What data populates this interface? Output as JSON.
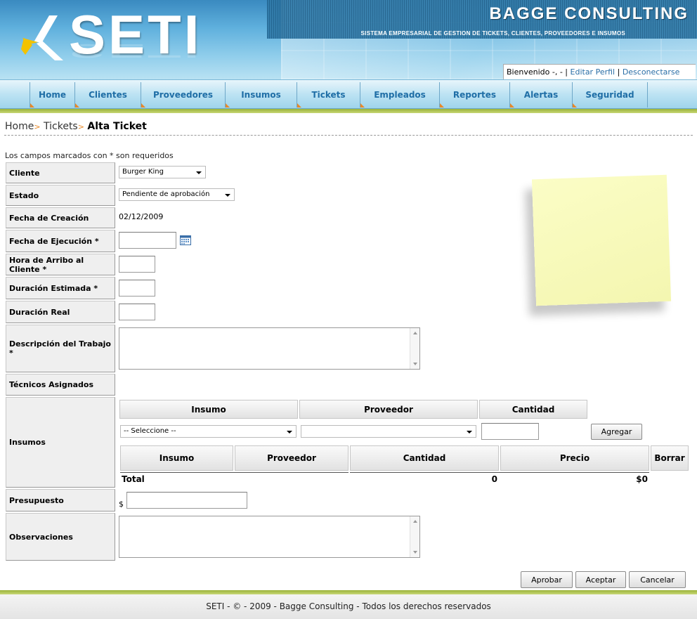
{
  "header": {
    "logo_text": "SETI",
    "company": "BAGGE CONSULTING",
    "tagline": "SISTEMA EMPRESARIAL DE GESTION DE TICKETS, CLIENTES, PROVEEDORES E INSUMOS",
    "welcome": "Bienvenido -, -",
    "separator": "|",
    "edit_profile": "Editar Perfil",
    "logout": "Desconectarse"
  },
  "nav": [
    "Home",
    "Clientes",
    "Proveedores",
    "Insumos",
    "Tickets",
    "Empleados",
    "Reportes",
    "Alertas",
    "Seguridad"
  ],
  "breadcrumb": {
    "home": "Home",
    "sep": ">",
    "tickets": "Tickets",
    "current": "Alta Ticket"
  },
  "required_note": "Los campos marcados con * son requeridos",
  "form": {
    "cliente_label": "Cliente",
    "cliente_value": "Burger King",
    "estado_label": "Estado",
    "estado_value": "Pendiente de aprobación",
    "fecha_creacion_label": "Fecha de Creación",
    "fecha_creacion_value": "02/12/2009",
    "fecha_ejecucion_label": "Fecha de Ejecución *",
    "hora_arribo_label": "Hora de Arribo al Cliente *",
    "duracion_estimada_label": "Duración Estimada *",
    "duracion_real_label": "Duración Real",
    "descripcion_label": "Descripción del Trabajo *",
    "tecnicos_label": "Técnicos Asignados",
    "insumos_label": "Insumos",
    "presupuesto_label": "Presupuesto",
    "presupuesto_prefix": "$",
    "observaciones_label": "Observaciones"
  },
  "insumos": {
    "add_headers": [
      "Insumo",
      "Proveedor",
      "Cantidad"
    ],
    "insumo_select": "-- Seleccione --",
    "proveedor_select": "",
    "add_button": "Agregar",
    "list_headers": [
      "Insumo",
      "Proveedor",
      "Cantidad",
      "Precio",
      "Borrar"
    ],
    "total_label": "Total",
    "total_cantidad": "0",
    "total_precio": "$0"
  },
  "buttons": {
    "approve": "Aprobar",
    "accept": "Aceptar",
    "cancel": "Cancelar"
  },
  "footer": "SETI - © - 2009 - Bagge Consulting - Todos los derechos reservados",
  "colors": {
    "nav_text": "#1f6ea6",
    "link": "#2a6ea6",
    "accent_orange": "#e88a2a",
    "green_bar": "#9ab33a",
    "sticky_note": "#fbfdc6"
  }
}
